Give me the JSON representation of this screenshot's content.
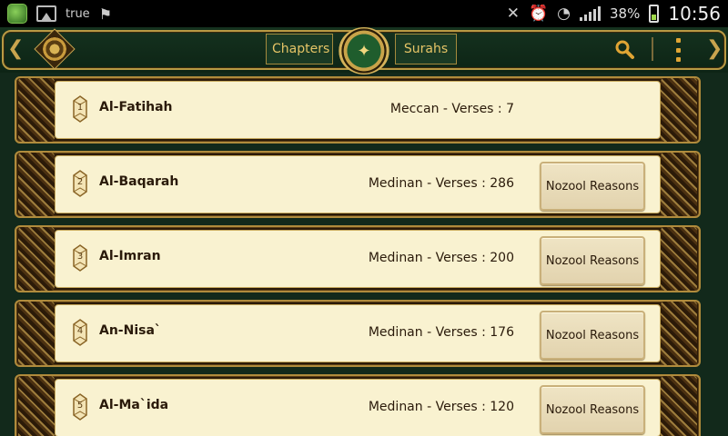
{
  "status_bar": {
    "carrier": "true",
    "battery_percent": "38%",
    "time": "10:56"
  },
  "action_bar": {
    "tabs": [
      {
        "label": "Chapters"
      },
      {
        "label": "Surahs"
      }
    ],
    "icons": [
      "search-icon",
      "overflow-menu-icon"
    ]
  },
  "surahs": [
    {
      "number": "1",
      "name": "Al-Fatihah",
      "info": "Meccan - Verses : 7",
      "button": ""
    },
    {
      "number": "2",
      "name": "Al-Baqarah",
      "info": "Medinan - Verses : 286",
      "button": "Nozool Reasons"
    },
    {
      "number": "3",
      "name": "Al-Imran",
      "info": "Medinan - Verses : 200",
      "button": "Nozool Reasons"
    },
    {
      "number": "4",
      "name": "An-Nisa`",
      "info": "Medinan - Verses : 176",
      "button": "Nozool Reasons"
    },
    {
      "number": "5",
      "name": "Al-Ma`ida",
      "info": "Medinan - Verses : 120",
      "button": "Nozool Reasons"
    }
  ],
  "colors": {
    "accent_gold": "#c9a44e",
    "card_bg": "#f9f2d0",
    "header_green": "#15321f"
  }
}
